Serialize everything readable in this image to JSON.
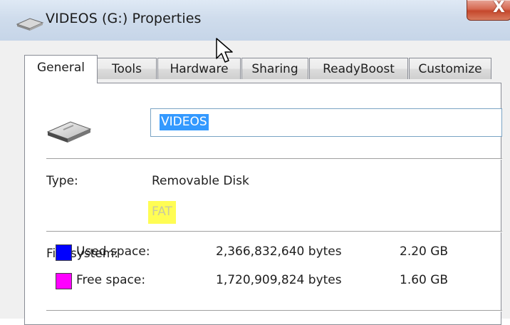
{
  "window": {
    "title": "VIDEOS (G:) Properties",
    "close_glyph": "X",
    "icon": "removable-drive-icon"
  },
  "tabs": [
    {
      "label": "General",
      "active": true
    },
    {
      "label": "Tools",
      "active": false
    },
    {
      "label": "Hardware",
      "active": false
    },
    {
      "label": "Sharing",
      "active": false
    },
    {
      "label": "ReadyBoost",
      "active": false
    },
    {
      "label": "Customize",
      "active": false
    }
  ],
  "general": {
    "drive_icon": "removable-drive-icon",
    "name_value": "VIDEOS",
    "type_label": "Type:",
    "type_value": "Removable Disk",
    "fs_label": "File system:",
    "fs_value": "FAT",
    "used": {
      "label": "Used space:",
      "bytes": "2,366,832,640 bytes",
      "size": "2.20 GB",
      "color": "#0000ff"
    },
    "free": {
      "label": "Free space:",
      "bytes": "1,720,909,824 bytes",
      "size": "1.60 GB",
      "color": "#ff00ff"
    }
  },
  "colors": {
    "highlight": "#fffd54",
    "selection": "#3399ff"
  }
}
